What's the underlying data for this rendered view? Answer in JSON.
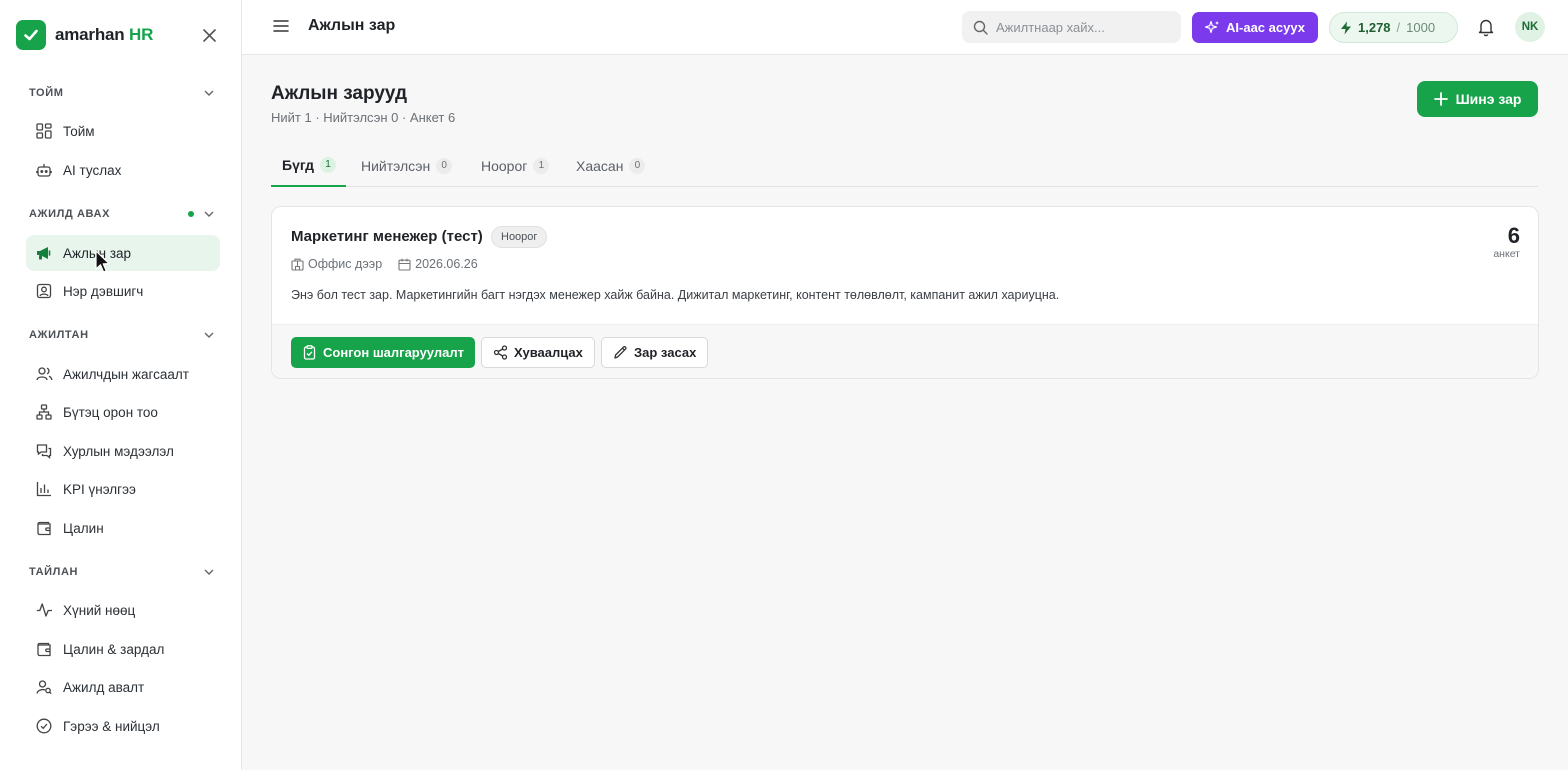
{
  "sidebar": {
    "brand": {
      "name": "amarhan",
      "suffix": "HR"
    },
    "sections": [
      {
        "title": "ТОЙМ",
        "items": [
          {
            "label": "Тойм",
            "icon": "dashboard-icon"
          },
          {
            "label": "AI туслах",
            "icon": "robot-icon"
          }
        ]
      },
      {
        "title": "АЖИЛД АВАХ",
        "items": [
          {
            "label": "Ажлын зар",
            "icon": "megaphone-icon",
            "active": true
          },
          {
            "label": "Нэр дэвшигч",
            "icon": "contact-card-icon"
          }
        ]
      },
      {
        "title": "АЖИЛТАН",
        "items": [
          {
            "label": "Ажилчдын жагсаалт",
            "icon": "users-icon"
          },
          {
            "label": "Бүтэц орон тоо",
            "icon": "org-chart-icon"
          },
          {
            "label": "Хурлын мэдээлэл",
            "icon": "chat-icon"
          },
          {
            "label": "KPI үнэлгээ",
            "icon": "bar-chart-icon"
          },
          {
            "label": "Цалин",
            "icon": "wallet-icon"
          }
        ]
      },
      {
        "title": "ТАЙЛАН",
        "items": [
          {
            "label": "Хүний нөөц",
            "icon": "activity-icon"
          },
          {
            "label": "Цалин & зардал",
            "icon": "wallet-icon"
          },
          {
            "label": "Ажилд авалт",
            "icon": "user-search-icon"
          },
          {
            "label": "Гэрээ & нийцэл",
            "icon": "check-circle-icon"
          }
        ]
      }
    ]
  },
  "topbar": {
    "title": "Ажлын зар",
    "search_placeholder": "Ажилтнаар хайх...",
    "ai_button": "AI-аас асуух",
    "credits": {
      "used": "1,278",
      "separator": "/",
      "total": "1000"
    },
    "avatar_initials": "NK"
  },
  "main": {
    "title": "Ажлын зарууд",
    "subtitle": "Нийт 1 · Нийтэлсэн 0 · Анкет 6",
    "new_button": "Шинэ зар",
    "tabs": [
      {
        "label": "Бүгд",
        "count": "1",
        "active": true
      },
      {
        "label": "Нийтэлсэн",
        "count": "0"
      },
      {
        "label": "Ноорог",
        "count": "1"
      },
      {
        "label": "Хаасан",
        "count": "0"
      }
    ],
    "job": {
      "title": "Маркетинг менежер (тест)",
      "status": "Ноорог",
      "location": "Оффис дээр",
      "date": "2026.06.26",
      "description": "Энэ бол тест зар. Маркетингийн багт нэгдэх менежер хайж байна. Дижитал маркетинг, контент төлөвлөлт, кампанит ажил хариуцна.",
      "applicants_count": "6",
      "applicants_label": "анкет",
      "actions": {
        "screening": "Сонгон шалгаруулалт",
        "share": "Хуваалцах",
        "edit": "Зар засах"
      }
    }
  },
  "colors": {
    "brand": "#16a34a",
    "ai": "#7c3aed",
    "active_bg": "#e8f5ec"
  }
}
